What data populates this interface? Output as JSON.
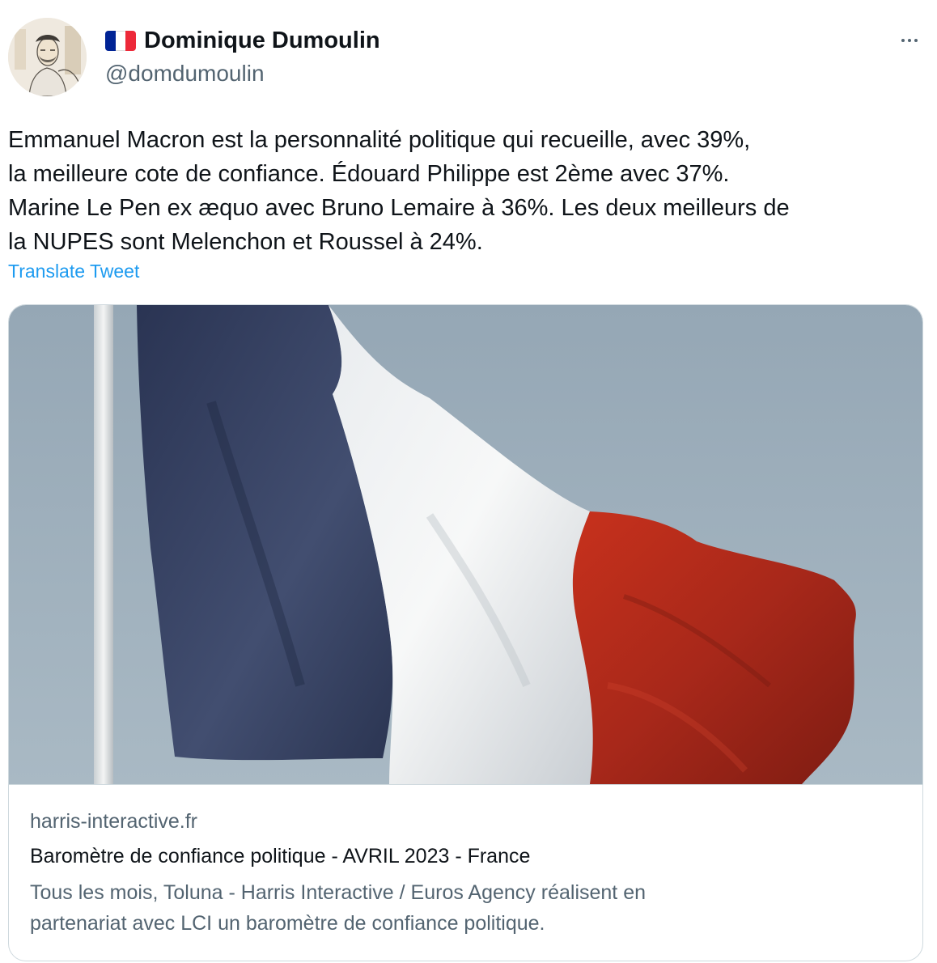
{
  "author": {
    "flag_icon": "french-flag-icon",
    "name": "Dominique Dumoulin",
    "handle": "@domdumoulin",
    "avatar_icon": "profile-photo-sketch"
  },
  "menu": {
    "icon": "more-options-icon"
  },
  "tweet": {
    "text": "Emmanuel Macron est la personnalité politique qui recueille, avec 39%,\nla meilleure cote de confiance. Édouard Philippe est 2ème avec 37%.\nMarine Le Pen ex æquo avec Bruno Lemaire à 36%. Les deux meilleurs de\nla NUPES sont Melenchon et Roussel à 24%.",
    "translate_label": "Translate Tweet"
  },
  "card": {
    "image_icon": "french-flag-photo",
    "domain": "harris-interactive.fr",
    "title": "Baromètre de confiance politique - AVRIL 2023 - France",
    "description": "Tous les mois, Toluna - Harris Interactive / Euros Agency réalisent en\npartenariat avec LCI un baromètre de confiance politique."
  },
  "colors": {
    "link": "#1d9bf0",
    "secondary_text": "#536471",
    "border": "#cfd9de",
    "flag_blue": "#002395",
    "flag_red": "#ed2939"
  }
}
